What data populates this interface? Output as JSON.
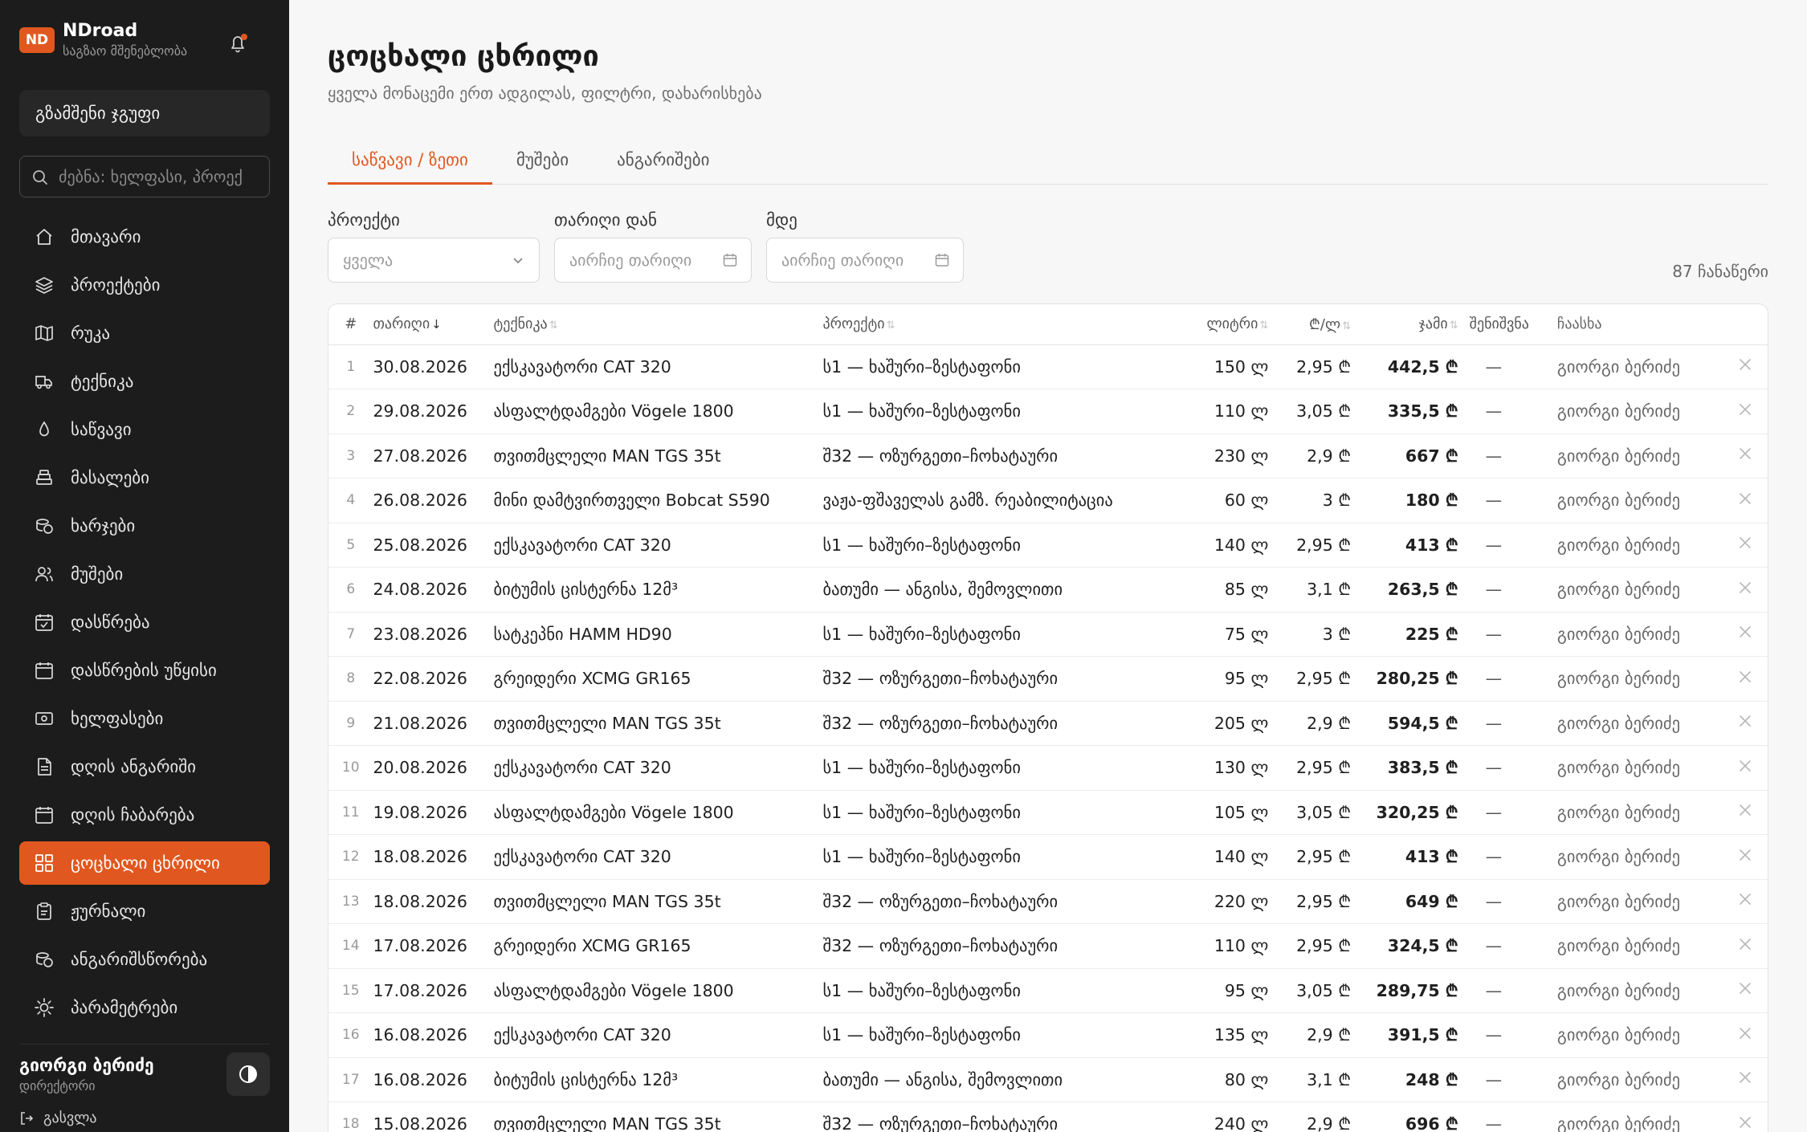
{
  "brand": {
    "badge": "ND",
    "name": "NDroad",
    "subtitle": "საგზაო მშენებლობა"
  },
  "sidebar": {
    "group_button": "გზამშენი ჯგუფი",
    "search_placeholder": "ძებნა: ხელფასი, პროექ",
    "items": [
      {
        "label": "მთავარი",
        "icon": "home-icon"
      },
      {
        "label": "პროექტები",
        "icon": "layers-icon"
      },
      {
        "label": "რუკა",
        "icon": "map-icon"
      },
      {
        "label": "ტექნიკა",
        "icon": "truck-icon"
      },
      {
        "label": "საწვავი",
        "icon": "drop-icon"
      },
      {
        "label": "მასალები",
        "icon": "stack-icon"
      },
      {
        "label": "ხარჯები",
        "icon": "coins-icon"
      },
      {
        "label": "მუშები",
        "icon": "users-icon"
      },
      {
        "label": "დასწრება",
        "icon": "calendar-check-icon"
      },
      {
        "label": "დასწრების უწყისი",
        "icon": "calendar-icon"
      },
      {
        "label": "ხელფასები",
        "icon": "banknote-icon"
      },
      {
        "label": "დღის ანგარიში",
        "icon": "file-icon"
      },
      {
        "label": "დღის ჩაბარება",
        "icon": "calendar-icon"
      },
      {
        "label": "ცოცხალი ცხრილი",
        "icon": "grid-icon",
        "active": true
      },
      {
        "label": "ჟურნალი",
        "icon": "clipboard-icon"
      },
      {
        "label": "ანგარიშსწორება",
        "icon": "coins-icon"
      },
      {
        "label": "პარამეტრები",
        "icon": "sun-gear-icon"
      }
    ],
    "user_name": "გიორგი ბერიძე",
    "user_role": "დირექტორი",
    "logout": "გასვლა"
  },
  "page": {
    "title": "ცოცხალი ცხრილი",
    "subtitle": "ყველა მონაცემი ერთ ადგილას, ფილტრი, დახარისხება",
    "tabs": [
      "საწვავი / ზეთი",
      "მუშები",
      "ანგარიშები"
    ],
    "filters": {
      "project_label": "პროექტი",
      "project_value": "ყველა",
      "date_from_label": "თარიღი დან",
      "date_to_label": "მდე",
      "date_placeholder": "აირჩიე თარიღი"
    },
    "record_count": "87 ჩანაწერი"
  },
  "table": {
    "headers": [
      "#",
      "თარიღი",
      "ტექნიკა",
      "პროექტი",
      "ლიტრი",
      "₾/ლ",
      "ჯამი",
      "შენიშვნა",
      "ჩაასხა"
    ],
    "sort_down": "↓",
    "sort_both": "⇅",
    "rows": [
      [
        "1",
        "30.08.2026",
        "ექსკავატორი CAT 320",
        "ს1 — ხაშური–ზესტაფონი",
        "150 ლ",
        "2,95 ₾",
        "442,5 ₾",
        "—",
        "გიორგი ბერიძე"
      ],
      [
        "2",
        "29.08.2026",
        "ასფალტდამგები Vögele 1800",
        "ს1 — ხაშური–ზესტაფონი",
        "110 ლ",
        "3,05 ₾",
        "335,5 ₾",
        "—",
        "გიორგი ბერიძე"
      ],
      [
        "3",
        "27.08.2026",
        "თვითმცლელი MAN TGS 35t",
        "შ32 — ოზურგეთი–ჩოხატაური",
        "230 ლ",
        "2,9 ₾",
        "667 ₾",
        "—",
        "გიორგი ბერიძე"
      ],
      [
        "4",
        "26.08.2026",
        "მინი დამტვირთველი Bobcat S590",
        "ვაჟა-ფშაველას გამზ. რეაბილიტაცია",
        "60 ლ",
        "3 ₾",
        "180 ₾",
        "—",
        "გიორგი ბერიძე"
      ],
      [
        "5",
        "25.08.2026",
        "ექსკავატორი CAT 320",
        "ს1 — ხაშური–ზესტაფონი",
        "140 ლ",
        "2,95 ₾",
        "413 ₾",
        "—",
        "გიორგი ბერიძე"
      ],
      [
        "6",
        "24.08.2026",
        "ბიტუმის ცისტერნა 12მ³",
        "ბათუმი — ანგისა, შემოვლითი",
        "85 ლ",
        "3,1 ₾",
        "263,5 ₾",
        "—",
        "გიორგი ბერიძე"
      ],
      [
        "7",
        "23.08.2026",
        "სატკეპნი HAMM HD90",
        "ს1 — ხაშური–ზესტაფონი",
        "75 ლ",
        "3 ₾",
        "225 ₾",
        "—",
        "გიორგი ბერიძე"
      ],
      [
        "8",
        "22.08.2026",
        "გრეიდერი XCMG GR165",
        "შ32 — ოზურგეთი–ჩოხატაური",
        "95 ლ",
        "2,95 ₾",
        "280,25 ₾",
        "—",
        "გიორგი ბერიძე"
      ],
      [
        "9",
        "21.08.2026",
        "თვითმცლელი MAN TGS 35t",
        "შ32 — ოზურგეთი–ჩოხატაური",
        "205 ლ",
        "2,9 ₾",
        "594,5 ₾",
        "—",
        "გიორგი ბერიძე"
      ],
      [
        "10",
        "20.08.2026",
        "ექსკავატორი CAT 320",
        "ს1 — ხაშური–ზესტაფონი",
        "130 ლ",
        "2,95 ₾",
        "383,5 ₾",
        "—",
        "გიორგი ბერიძე"
      ],
      [
        "11",
        "19.08.2026",
        "ასფალტდამგები Vögele 1800",
        "ს1 — ხაშური–ზესტაფონი",
        "105 ლ",
        "3,05 ₾",
        "320,25 ₾",
        "—",
        "გიორგი ბერიძე"
      ],
      [
        "12",
        "18.08.2026",
        "ექსკავატორი CAT 320",
        "ს1 — ხაშური–ზესტაფონი",
        "140 ლ",
        "2,95 ₾",
        "413 ₾",
        "—",
        "გიორგი ბერიძე"
      ],
      [
        "13",
        "18.08.2026",
        "თვითმცლელი MAN TGS 35t",
        "შ32 — ოზურგეთი–ჩოხატაური",
        "220 ლ",
        "2,95 ₾",
        "649 ₾",
        "—",
        "გიორგი ბერიძე"
      ],
      [
        "14",
        "17.08.2026",
        "გრეიდერი XCMG GR165",
        "შ32 — ოზურგეთი–ჩოხატაური",
        "110 ლ",
        "2,95 ₾",
        "324,5 ₾",
        "—",
        "გიორგი ბერიძე"
      ],
      [
        "15",
        "17.08.2026",
        "ასფალტდამგები Vögele 1800",
        "ს1 — ხაშური–ზესტაფონი",
        "95 ლ",
        "3,05 ₾",
        "289,75 ₾",
        "—",
        "გიორგი ბერიძე"
      ],
      [
        "16",
        "16.08.2026",
        "ექსკავატორი CAT 320",
        "ს1 — ხაშური–ზესტაფონი",
        "135 ლ",
        "2,9 ₾",
        "391,5 ₾",
        "—",
        "გიორგი ბერიძე"
      ],
      [
        "17",
        "16.08.2026",
        "ბიტუმის ცისტერნა 12მ³",
        "ბათუმი — ანგისა, შემოვლითი",
        "80 ლ",
        "3,1 ₾",
        "248 ₾",
        "—",
        "გიორგი ბერიძე"
      ],
      [
        "18",
        "15.08.2026",
        "თვითმცლელი MAN TGS 35t",
        "შ32 — ოზურგეთი–ჩოხატაური",
        "240 ლ",
        "2,9 ₾",
        "696 ₾",
        "—",
        "გიორგი ბერიძე"
      ]
    ]
  },
  "colors": {
    "accent": "#e0581f",
    "sidebar_bg": "#1c1c1c",
    "page_bg": "#f7f7f7"
  }
}
